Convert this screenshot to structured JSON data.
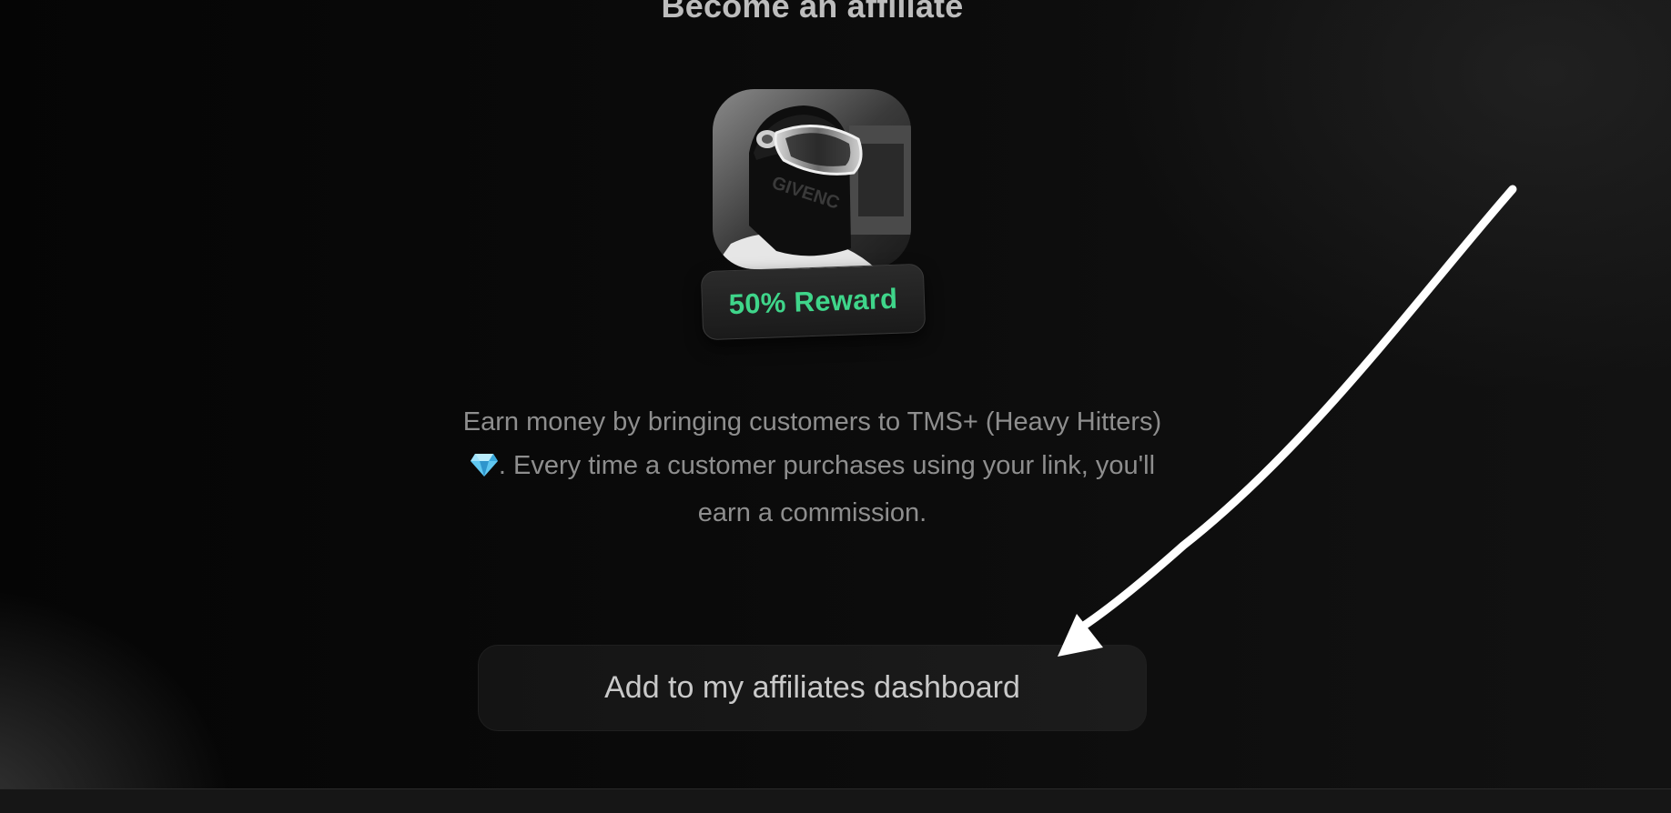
{
  "heading": "Become an affiliate",
  "badge": {
    "label": "50% Reward",
    "color": "#3fd58a"
  },
  "description": {
    "part1": "Earn money by bringing customers to TMS+ (Heavy Hitters)",
    "part2": ". Every time a customer purchases using your link, you'll earn a commission.",
    "icon": "gem-icon"
  },
  "cta": {
    "label": "Add to my affiliates dashboard"
  },
  "annotation": {
    "icon": "arrow-icon",
    "color": "#ffffff"
  }
}
